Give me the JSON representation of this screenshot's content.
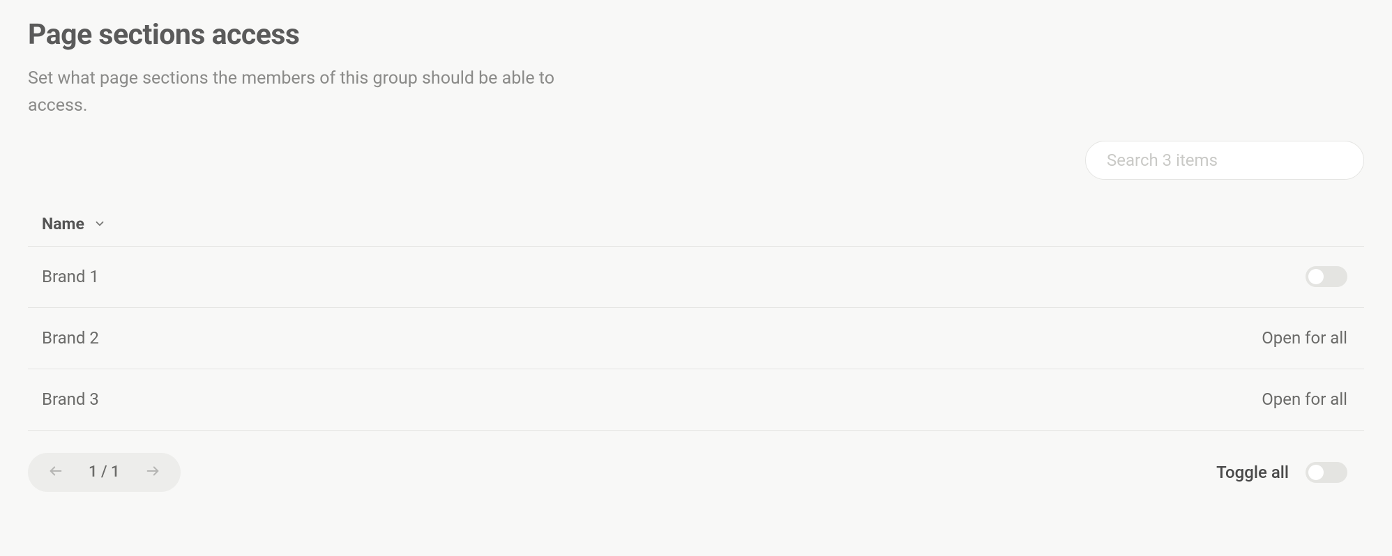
{
  "header": {
    "title": "Page sections access",
    "description": "Set what page sections the members of this group should be able to access."
  },
  "search": {
    "placeholder": "Search 3 items"
  },
  "table": {
    "columns": {
      "name": "Name"
    },
    "rows": [
      {
        "name": "Brand 1",
        "status_type": "toggle",
        "status": ""
      },
      {
        "name": "Brand 2",
        "status_type": "text",
        "status": "Open for all"
      },
      {
        "name": "Brand 3",
        "status_type": "text",
        "status": "Open for all"
      }
    ]
  },
  "pagination": {
    "text": "1 / 1"
  },
  "footer": {
    "toggle_all_label": "Toggle all"
  }
}
